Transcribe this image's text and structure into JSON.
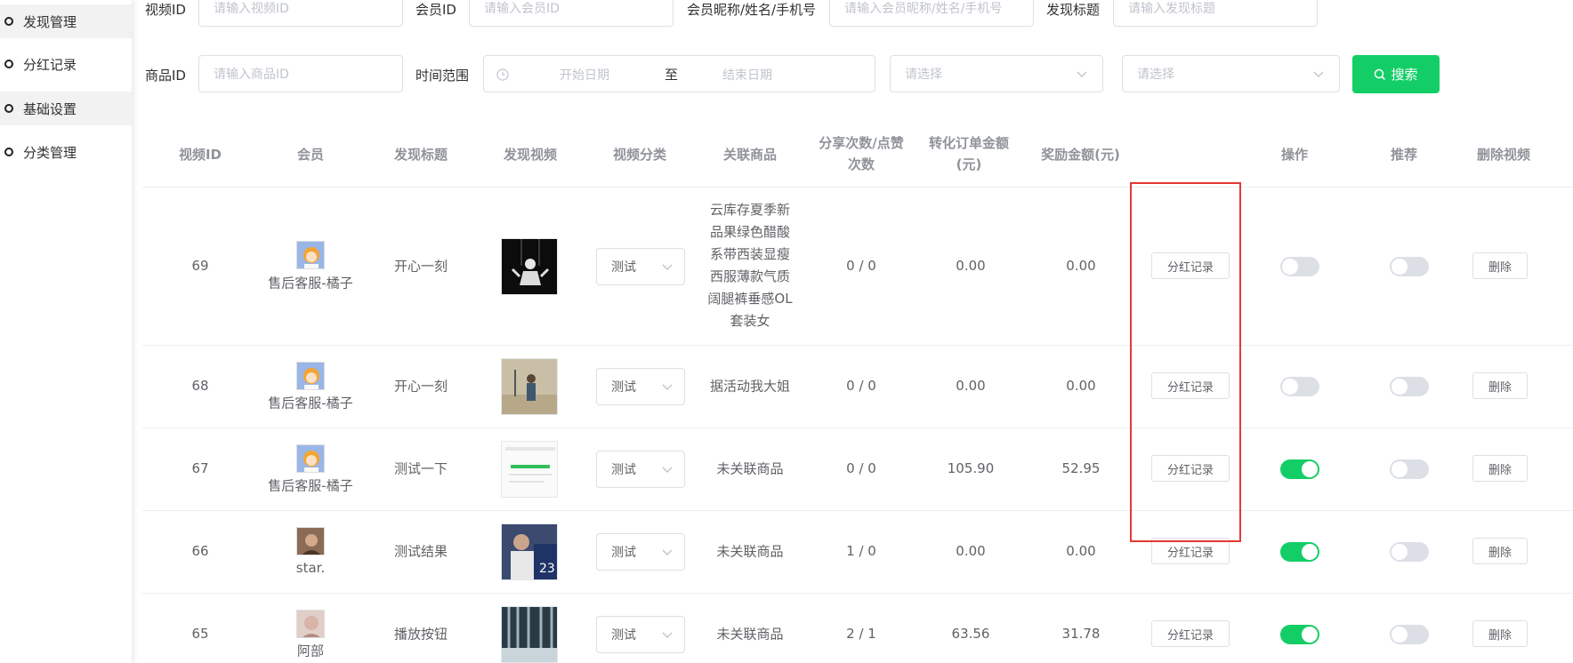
{
  "sidebar": {
    "items": [
      {
        "label": "发现管理"
      },
      {
        "label": "分红记录"
      },
      {
        "label": "基础设置"
      },
      {
        "label": "分类管理"
      }
    ]
  },
  "filters": {
    "video_id": {
      "label": "视频ID",
      "placeholder": "请输入视频ID"
    },
    "member_id": {
      "label": "会员ID",
      "placeholder": "请输入会员ID"
    },
    "member_name": {
      "label": "会员昵称/姓名/手机号",
      "placeholder": "请输入会员昵称/姓名/手机号"
    },
    "title": {
      "label": "发现标题",
      "placeholder": "请输入发现标题"
    },
    "product_id": {
      "label": "商品ID",
      "placeholder": "请输入商品ID"
    },
    "time_range": {
      "label": "时间范围",
      "start_placeholder": "开始日期",
      "separator": "至",
      "end_placeholder": "结束日期"
    },
    "select1": {
      "placeholder": "请选择"
    },
    "select2": {
      "placeholder": "请选择"
    },
    "search_label": "搜索"
  },
  "table": {
    "headers": {
      "video_id": "视频ID",
      "member": "会员",
      "title": "发现标题",
      "video": "发现视频",
      "category": "视频分类",
      "product": "关联商品",
      "share_line1": "分享次数/点赞",
      "share_line2": "次数",
      "order_line1": "转化订单金额",
      "order_line2": "(元)",
      "reward": "奖励金额(元)",
      "op": "操作",
      "recommend": "推荐",
      "delete": "删除视频"
    },
    "rows": [
      {
        "id": "69",
        "member": "售后客服-橘子",
        "title": "开心一刻",
        "category": "测试",
        "product_lines": [
          "云库存夏季新",
          "品果绿色醋酸",
          "系带西装显瘦",
          "西服薄款气质",
          "阔腿裤垂感OL",
          "套装女"
        ],
        "share": "0 / 0",
        "order": "0.00",
        "reward": "0.00",
        "record_btn": "分红记录",
        "op_on": false,
        "rec_on": false,
        "delete_btn": "删除"
      },
      {
        "id": "68",
        "member": "售后客服-橘子",
        "title": "开心一刻",
        "category": "测试",
        "product_lines": [
          "据活动我大姐"
        ],
        "share": "0 / 0",
        "order": "0.00",
        "reward": "0.00",
        "record_btn": "分红记录",
        "op_on": false,
        "rec_on": false,
        "delete_btn": "删除"
      },
      {
        "id": "67",
        "member": "售后客服-橘子",
        "title": "测试一下",
        "category": "测试",
        "product_lines": [
          "未关联商品"
        ],
        "share": "0 / 0",
        "order": "105.90",
        "reward": "52.95",
        "record_btn": "分红记录",
        "op_on": true,
        "rec_on": false,
        "delete_btn": "删除"
      },
      {
        "id": "66",
        "member": "star.",
        "title": "测试结果",
        "category": "测试",
        "product_lines": [
          "未关联商品"
        ],
        "share": "1 / 0",
        "order": "0.00",
        "reward": "0.00",
        "record_btn": "分红记录",
        "op_on": true,
        "rec_on": false,
        "delete_btn": "删除"
      },
      {
        "id": "65",
        "member": "阿部",
        "title": "播放按钮",
        "category": "测试",
        "product_lines": [
          "未关联商品"
        ],
        "share": "2 / 1",
        "order": "63.56",
        "reward": "31.78",
        "record_btn": "分红记录",
        "op_on": true,
        "rec_on": false,
        "delete_btn": "删除"
      }
    ]
  },
  "colors": {
    "accent": "#13ce66",
    "highlight": "#e53935"
  }
}
